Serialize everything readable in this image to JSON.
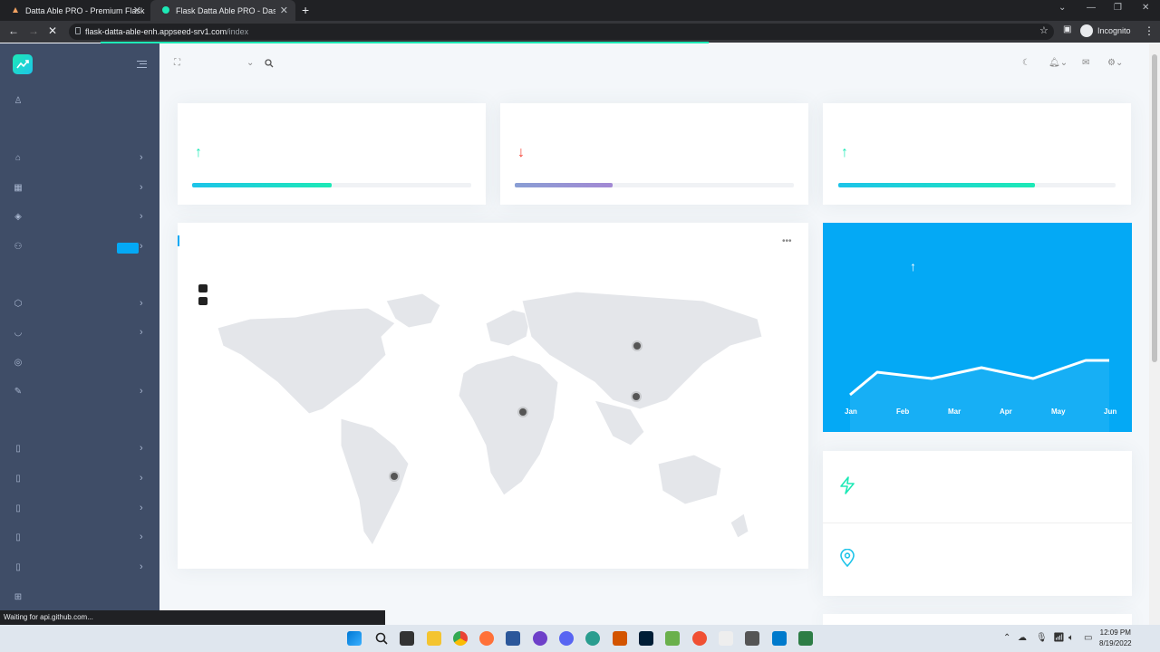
{
  "browser": {
    "tabs": [
      {
        "title": "Datta Able PRO - Premium Flask",
        "active": false
      },
      {
        "title": "Flask Datta Able PRO - Dashboard",
        "active": true
      }
    ],
    "url_host": "flask-datta-able-enh.appseed-srv1.com",
    "url_path": "/index",
    "profile_label": "Incognito",
    "status_text": "Waiting for api.github.com...",
    "page_load_progress": 0.6
  },
  "sidebar": {
    "items": [
      {
        "icon": "user-icon"
      },
      {
        "icon": "home-icon",
        "has_chevron": true
      },
      {
        "icon": "layout-icon",
        "has_chevron": true
      },
      {
        "icon": "layers-icon",
        "has_chevron": true
      },
      {
        "icon": "users-icon",
        "has_chevron": true,
        "has_badge": true
      },
      {
        "icon": "box-icon",
        "has_chevron": true
      },
      {
        "icon": "gitlab-icon",
        "has_chevron": true
      },
      {
        "icon": "globe-icon"
      },
      {
        "icon": "feather-icon",
        "has_chevron": true
      },
      {
        "icon": "file-icon",
        "has_chevron": true
      },
      {
        "icon": "file-icon",
        "has_chevron": true
      },
      {
        "icon": "file-icon",
        "has_chevron": true
      },
      {
        "icon": "file-icon",
        "has_chevron": true
      },
      {
        "icon": "file-icon",
        "has_chevron": true
      },
      {
        "icon": "grid-icon"
      }
    ]
  },
  "stats": [
    {
      "direction": "up",
      "progress": 0.5,
      "color": "#1de9b6"
    },
    {
      "direction": "down",
      "progress": 0.35,
      "color": "#a389d4"
    },
    {
      "direction": "up",
      "progress": 0.71,
      "color": "#1de9b6"
    }
  ],
  "map_card": {
    "markers": [
      "Russia",
      "Egypt",
      "China",
      "Brazil"
    ]
  },
  "sales_chart": {
    "months": [
      "Jan",
      "Feb",
      "Mar",
      "Apr",
      "May",
      "Jun"
    ]
  },
  "colors": {
    "sidebar": "#3f4d67",
    "accent": "#04a9f5",
    "success": "#1de9b6",
    "danger": "#f44236"
  },
  "taskbar": {
    "time": "12:09 PM",
    "date": "8/19/2022"
  }
}
